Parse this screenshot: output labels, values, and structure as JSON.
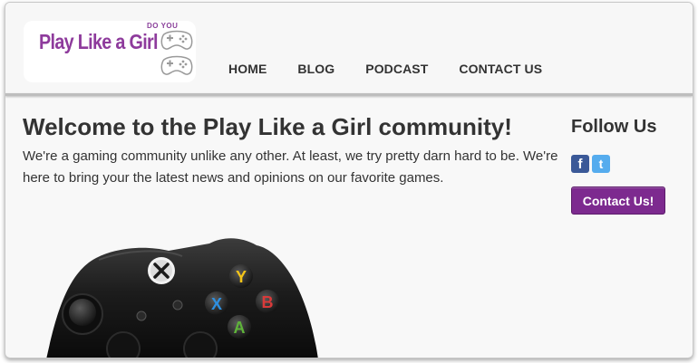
{
  "logo": {
    "small_text": "DO YOU",
    "main_text": "Play Like a Girl",
    "controller_icon": "game-controller-icon"
  },
  "nav": {
    "items": [
      {
        "label": "HOME"
      },
      {
        "label": "BLOG"
      },
      {
        "label": "PODCAST"
      },
      {
        "label": "CONTACT US"
      }
    ]
  },
  "main": {
    "title": "Welcome to the Play Like a Girl community!",
    "intro": "We're a gaming community unlike any other. At least, we try pretty darn hard to be. We're here to bring your the latest news and opinions on our favorite games.",
    "hero_image": "xbox-controller-image",
    "controller_buttons": {
      "y": "Y",
      "x": "X",
      "b": "B",
      "a": "A"
    }
  },
  "sidebar": {
    "follow_title": "Follow Us",
    "social": [
      {
        "icon": "facebook-icon",
        "glyph": "f",
        "color": "#3b5998"
      },
      {
        "icon": "twitter-icon",
        "glyph": "t",
        "color": "#55acee"
      }
    ],
    "contact_button": "Contact Us!"
  },
  "colors": {
    "brand_purple": "#8e3b9c",
    "button_purple": "#7d2a8f",
    "text": "#333333"
  }
}
